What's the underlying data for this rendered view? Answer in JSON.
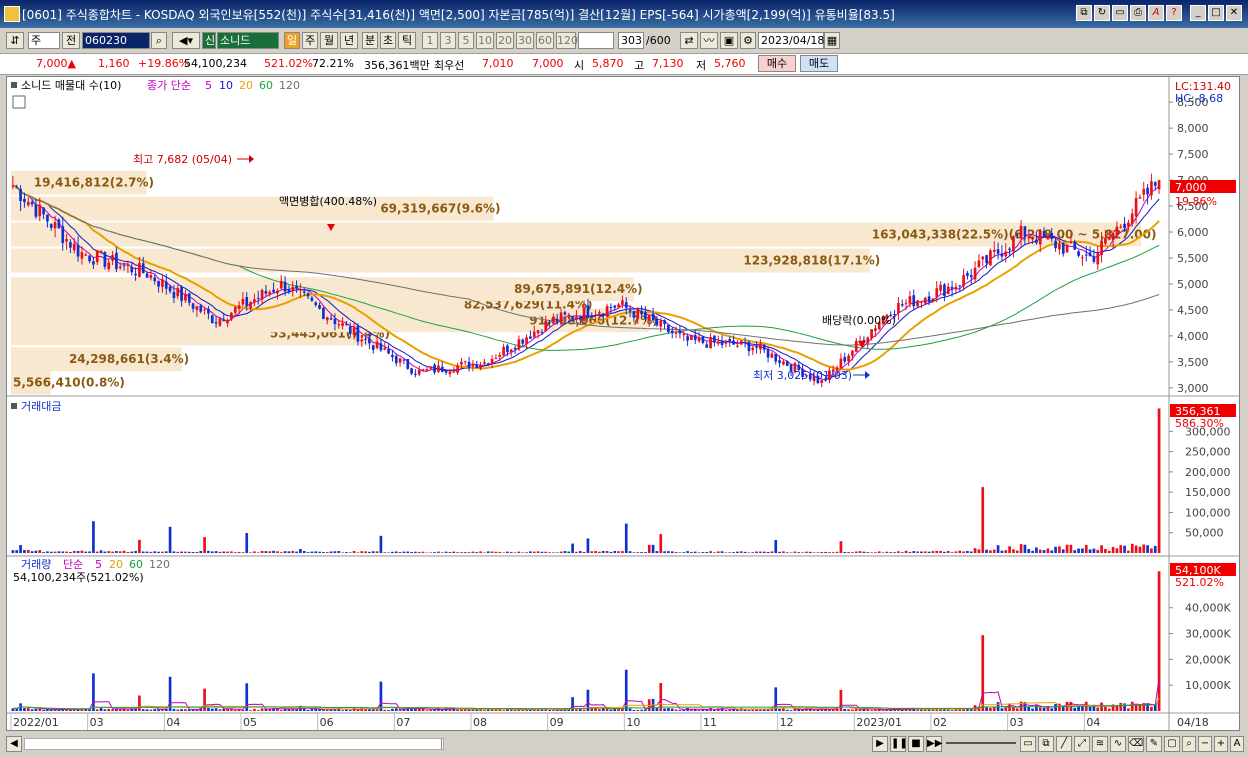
{
  "window": {
    "title": "[0601] 주식종합차트 - KOSDAQ 외국인보유[552(천)] 주식수[31,416(천)] 액면[2,500] 자본금[785(억)] 결산[12월] EPS[-564] 시가총액[2,199(억)] 유통비율[83.5]"
  },
  "toolbar": {
    "market": "주",
    "prev": "전",
    "code": "060230",
    "name_prefix": "신",
    "stock_name": "소니드",
    "periods": [
      "일",
      "주",
      "월",
      "년",
      "분",
      "초",
      "틱"
    ],
    "intervals": [
      "1",
      "3",
      "5",
      "10",
      "20",
      "30",
      "60",
      "120"
    ],
    "count": "303",
    "count_total": "/600",
    "date": "2023/04/18"
  },
  "info": {
    "price": "7,000▲",
    "change": "1,160",
    "change_pct": "+19.86%",
    "volume": "54,100,234",
    "vol_ratio": "521.02%",
    "turnover": "72.21%",
    "amount": "356,361백만",
    "best_label": "최우선",
    "ask": "7,010",
    "bid": "7,000",
    "open_label": "시",
    "open": "5,870",
    "high_label": "고",
    "high": "7,130",
    "low_label": "저",
    "low": "5,760",
    "buy": "매수",
    "sell": "매도"
  },
  "price_panel": {
    "legend_name": "소니드 매물대 수(10)",
    "legend_ma_label": "종가 단순",
    "ma_periods": [
      "5",
      "10",
      "20",
      "60",
      "120"
    ],
    "lc": "LC:131.40",
    "hc": "HC:-8.68",
    "y_ticks": [
      "8,500",
      "8,000",
      "7,500",
      "7,000",
      "6,500",
      "6,000",
      "5,500",
      "5,000",
      "4,500",
      "4,000",
      "3,500",
      "3,000"
    ],
    "current_price": "7,000",
    "current_pct": "19.86%",
    "high_note": "최고 7,682 (05/04)",
    "low_note": "최저 3,025 (01/03)",
    "split_note": "액면병합(400.48%)",
    "div_note": "배당락(0.00%)",
    "vp_labels": [
      "5,566,410(0.8%)",
      "24,298,661(3.4%)",
      "53,445,061(7.4%)",
      "91,698,066(12.7%)",
      "82,537,629(11.4%)",
      "89,675,891(12.4%)",
      "123,928,818(17.1%)",
      "163,043,338(22.5%)(6,218.00 ~ 5,827.00)",
      "69,319,667(9.6%)",
      "19,416,812(2.7%)"
    ]
  },
  "amount_panel": {
    "legend": "거래대금",
    "current": "356,361",
    "pct": "586.30%",
    "y_ticks": [
      "300,000",
      "250,000",
      "200,000",
      "150,000",
      "100,000",
      "50,000"
    ]
  },
  "volume_panel": {
    "legend_name": "거래량",
    "legend_ma_label": "단순",
    "ma_periods": [
      "5",
      "20",
      "60",
      "120"
    ],
    "current_text": "54,100,234주(521.02%)",
    "current": "54,100K",
    "pct": "521.02%",
    "y_ticks": [
      "40,000K",
      "30,000K",
      "20,000K",
      "10,000K"
    ]
  },
  "x_axis": {
    "labels": [
      "2022/01",
      "03",
      "04",
      "05",
      "06",
      "07",
      "08",
      "09",
      "10",
      "11",
      "12",
      "2023/01",
      "02",
      "03",
      "04"
    ],
    "right_label": "04/18"
  },
  "colors": {
    "up": "#e8101a",
    "down": "#1030d0",
    "ma5": "#c000c0",
    "ma10": "#1018c8",
    "ma20": "#e8a000",
    "ma60": "#20a040",
    "ma120": "#707070",
    "volume_profile": "#f8e8d0",
    "vp_text": "#8a5a10"
  },
  "chart_data": {
    "type": "candlestick",
    "y_range_price": [
      2900,
      8600
    ],
    "y_range_amount": [
      0,
      360000
    ],
    "y_range_volume": [
      0,
      55000
    ],
    "monthly_closes": [
      6900,
      5600,
      5200,
      4300,
      5000,
      4100,
      3300,
      3500,
      4300,
      4600,
      3900,
      3800,
      3100,
      4500,
      5000,
      6000,
      5500,
      7000
    ]
  }
}
